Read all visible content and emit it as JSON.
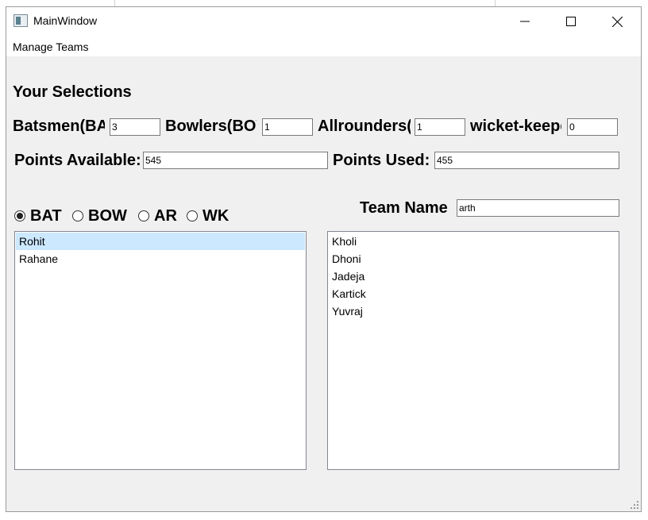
{
  "window": {
    "title": "MainWindow",
    "icon": "app-window-icon",
    "controls": [
      "minimize-icon",
      "maximize-icon",
      "close-icon"
    ]
  },
  "menu": {
    "items": [
      "Manage Teams"
    ]
  },
  "selections": {
    "heading": "Your Selections",
    "batsmen_label": "Batsmen(BAT)",
    "batsmen_value": "3",
    "bowlers_label": "Bowlers(BOW)",
    "bowlers_value": "1",
    "allrounders_label": "Allrounders(AR)",
    "allrounders_value": "1",
    "wicketkeepers_label": "wicket-keeper(WK)",
    "wicketkeepers_value": "0"
  },
  "points": {
    "available_label": "Points Available:",
    "available_value": "545",
    "used_label": "Points Used:",
    "used_value": "455"
  },
  "radios": {
    "selected": "BAT",
    "options": [
      "BAT",
      "BOW",
      "AR",
      "WK"
    ]
  },
  "team": {
    "label": "Team Name",
    "value": "arth"
  },
  "available_players": {
    "selected_index": 0,
    "items": [
      "Rohit",
      "Rahane"
    ]
  },
  "selected_players": {
    "items": [
      "Kholi",
      "Dhoni",
      "Jadeja",
      "Kartick",
      "Yuvraj"
    ]
  },
  "colors": {
    "selection_highlight": "#cce8ff",
    "window_bg": "#f0f0f0"
  }
}
